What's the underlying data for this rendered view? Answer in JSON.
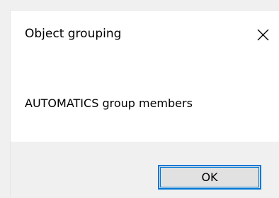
{
  "dialog": {
    "title": "Object grouping",
    "message": "AUTOMATICS group members",
    "ok_label": "OK",
    "close_icon": "close-icon"
  },
  "colors": {
    "accent": "#0078d7",
    "footer_bg": "#f0f0f0",
    "content_bg": "#ffffff",
    "button_bg": "#e1e1e1"
  }
}
